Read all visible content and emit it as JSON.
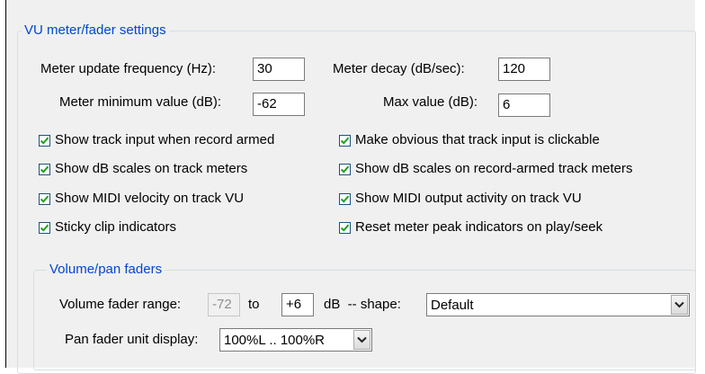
{
  "vu_group": {
    "title": "VU meter/fader settings",
    "update_freq": {
      "label": "Meter update frequency (Hz):",
      "value": "30"
    },
    "decay": {
      "label": "Meter decay (dB/sec):",
      "value": "120"
    },
    "min_value": {
      "label": "Meter minimum value (dB):",
      "value": "-62"
    },
    "max_value": {
      "label": "Max value (dB):",
      "value": "6"
    },
    "checkboxes": [
      {
        "label": "Show track input when record armed",
        "checked": true
      },
      {
        "label": "Make obvious that track input is clickable",
        "checked": true
      },
      {
        "label": "Show dB scales on track meters",
        "checked": true
      },
      {
        "label": "Show dB scales on record-armed track meters",
        "checked": true
      },
      {
        "label": "Show MIDI velocity on track VU",
        "checked": true
      },
      {
        "label": "Show MIDI output activity on track VU",
        "checked": true
      },
      {
        "label": "Sticky clip indicators",
        "checked": true
      },
      {
        "label": "Reset meter peak indicators on play/seek",
        "checked": true
      }
    ]
  },
  "faders_group": {
    "title": "Volume/pan faders",
    "range_label": "Volume fader range:",
    "range_min": "-72",
    "to_label": "to",
    "range_max": "+6",
    "db_shape_label": "dB  -- shape:",
    "shape_value": "Default",
    "pan_label": "Pan fader unit display:",
    "pan_value": "100%L .. 100%R"
  },
  "colors": {
    "group_title": "#0046d5",
    "check_mark": "#21a121",
    "panel_bg": "#f0f0f0"
  },
  "icons": {
    "check": "check-mark",
    "dropdown": "chevron-down-icon"
  }
}
